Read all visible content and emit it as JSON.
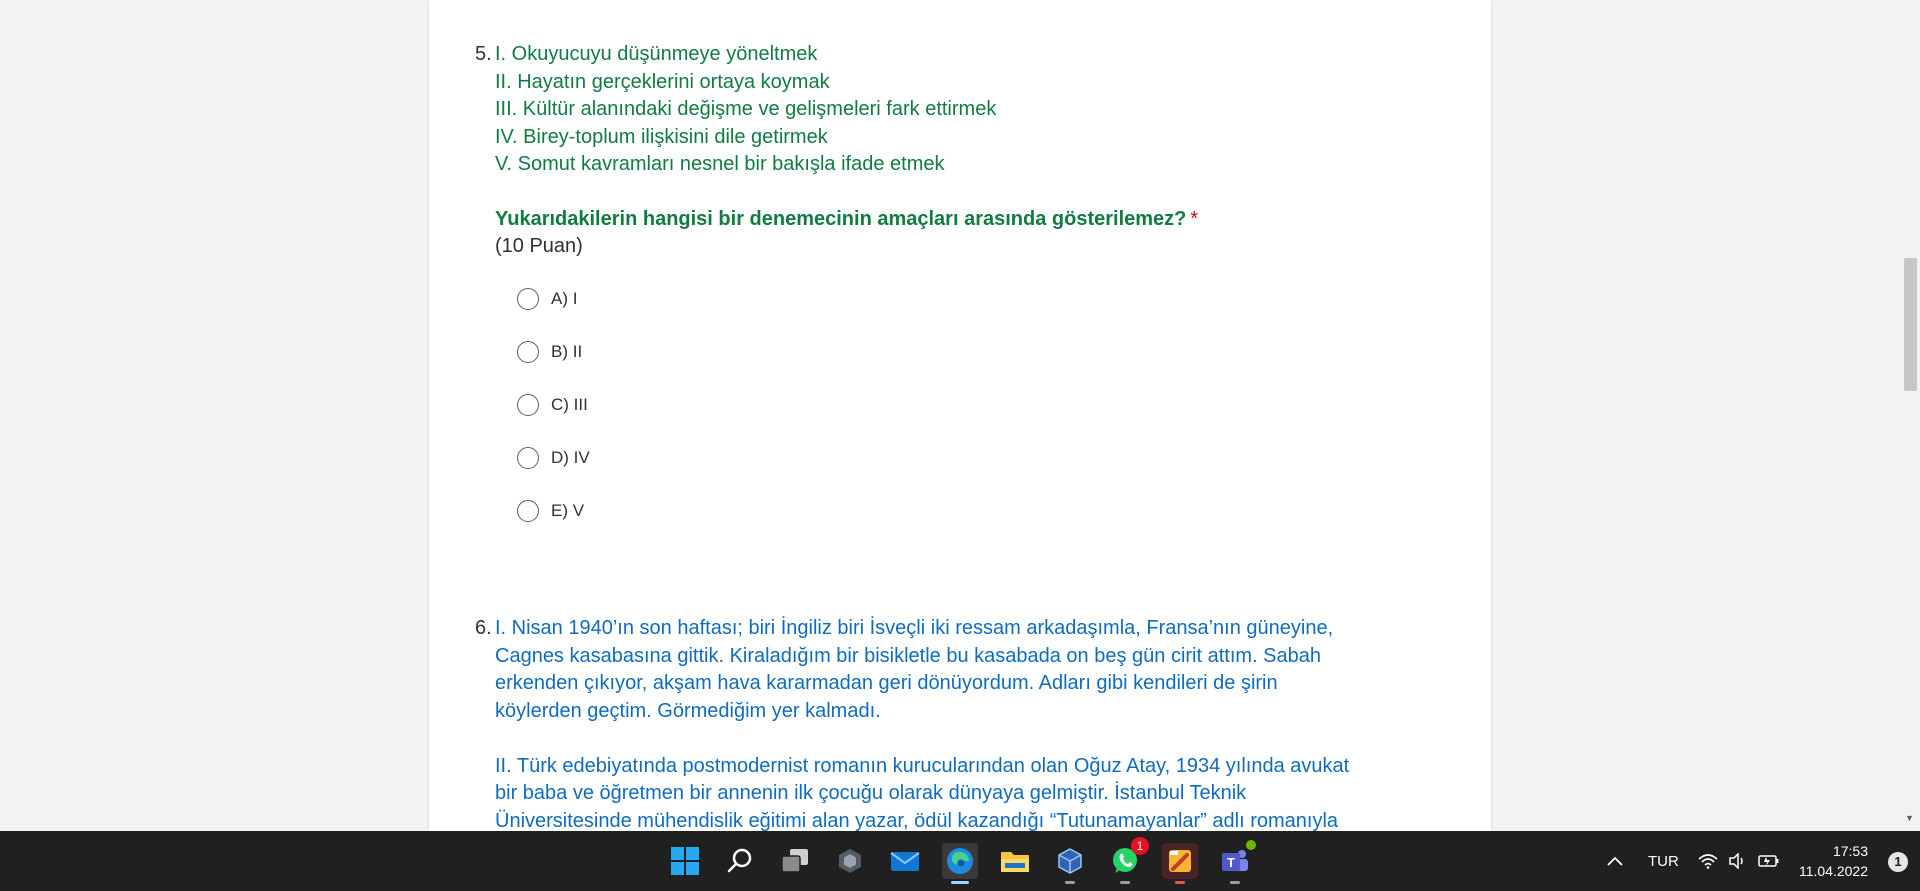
{
  "question5": {
    "number": "5.",
    "statements": [
      "I. Okuyucuyu düşünmeye yöneltmek",
      "II. Hayatın gerçeklerini ortaya koymak",
      "III. Kültür alanındaki değişme ve gelişmeleri fark ettirmek",
      "IV. Birey-toplum ilişkisini dile getirmek",
      "V. Somut kavramları nesnel bir bakışla ifade etmek"
    ],
    "prompt": "Yukarıdakilerin hangisi bir denemecinin amaçları arasında gösterilemez?",
    "required_mark": "*",
    "points": "(10 Puan)",
    "options": [
      "A) I",
      "B) II",
      "C) III",
      "D) IV",
      "E) V"
    ]
  },
  "question6": {
    "number": "6.",
    "paragraph1": [
      "I. Nisan 1940’ın son haftası; biri İngiliz biri İsveçli iki ressam arkadaşımla, Fransa’nın güneyine,",
      "Cagnes kasabasına gittik. Kiraladığım bir bisikletle bu kasabada on beş gün cirit attım. Sabah",
      "erkenden çıkıyor, akşam hava kararmadan geri dönüyordum. Adları gibi kendileri de şirin",
      "köylerden geçtim. Görmediğim yer kalmadı."
    ],
    "paragraph2": [
      "II. Türk edebiyatında postmodernist romanın kurucularından olan Oğuz Atay, 1934 yılında avukat",
      "bir baba ve öğretmen bir annenin ilk çocuğu olarak dünyaya gelmiştir. İstanbul Teknik",
      "Üniversitesinde mühendislik eğitimi alan yazar, ödül kazandığı “Tutunamayanlar” adlı romanıyla"
    ]
  },
  "taskbar": {
    "apps": [
      "start-icon",
      "search-icon",
      "task-view-icon",
      "widgets-icon",
      "mail-icon",
      "edge-icon",
      "file-explorer-icon",
      "virtualbox-icon",
      "whatsapp-icon",
      "paint-app-icon",
      "teams-icon"
    ],
    "whatsapp_badge": "1",
    "language": "TUR",
    "time": "17:53",
    "date": "11.04.2022",
    "notification_count": "1"
  },
  "colors": {
    "question5_text": "#107c41",
    "question6_text": "#0f6cbd",
    "required": "#c50f1f",
    "taskbar_bg": "#202020"
  }
}
